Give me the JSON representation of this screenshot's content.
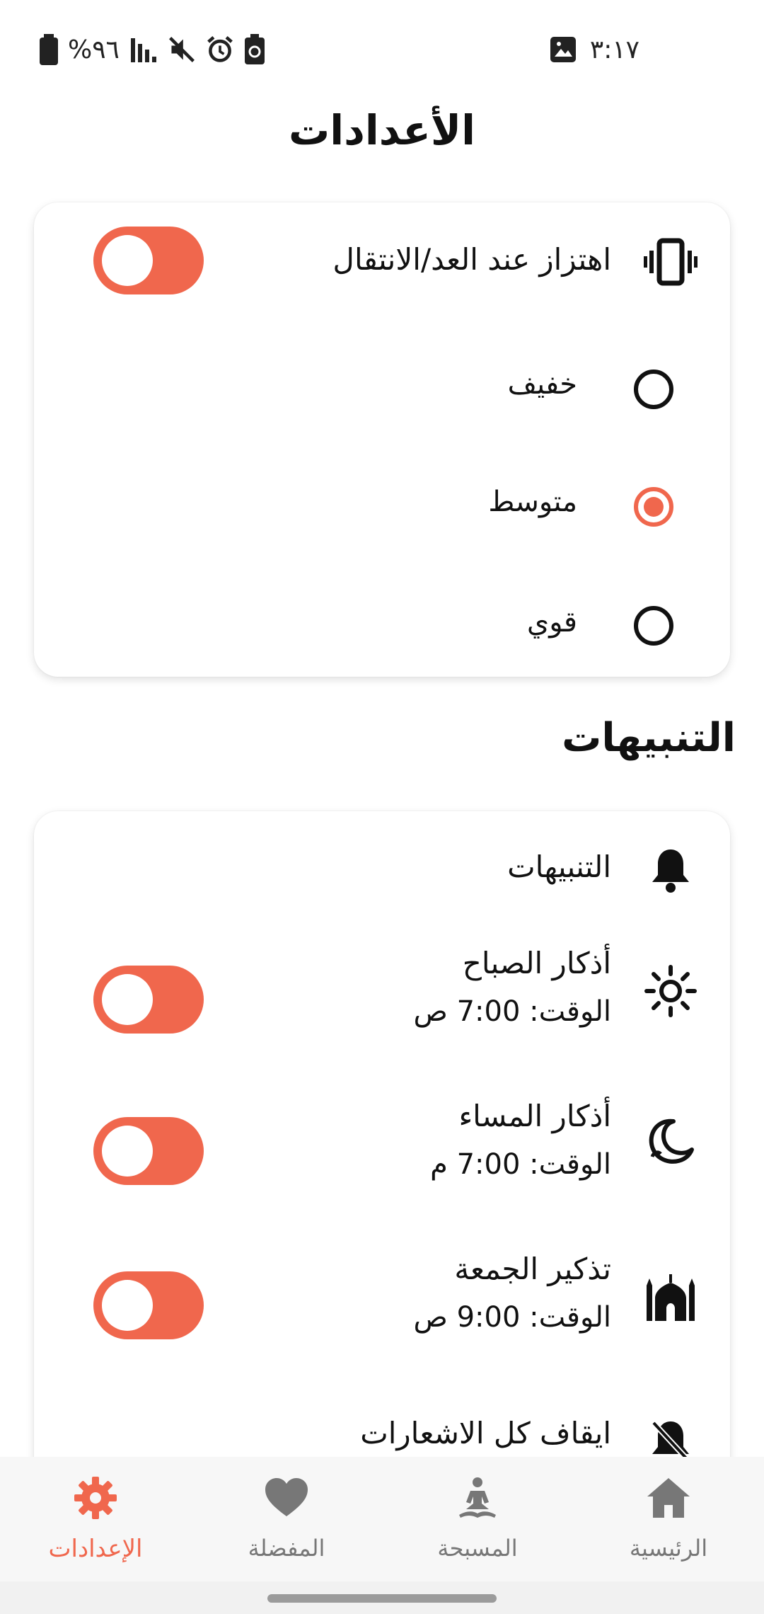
{
  "status_bar": {
    "time": "٣:١٧",
    "battery": "%٩٦",
    "icons": [
      "battery-icon",
      "signal-icon",
      "mute-icon",
      "alarm-icon",
      "battery-saver-icon",
      "gallery-icon"
    ]
  },
  "page": {
    "title": "الأعدادات"
  },
  "vibration": {
    "icon": "vibration-icon",
    "title": "اهتزاز عند العد/الانتقال",
    "enabled": true,
    "options": [
      {
        "label": "خفيف",
        "selected": false
      },
      {
        "label": "متوسط",
        "selected": true
      },
      {
        "label": "قوي",
        "selected": false
      }
    ]
  },
  "notifications_section": {
    "title": "التنبيهات",
    "header": {
      "icon": "bell-icon",
      "label": "التنبيهات"
    },
    "items": [
      {
        "icon": "sun-icon",
        "title": "أذكار الصباح",
        "time": "الوقت: 7:00 ص",
        "enabled": true
      },
      {
        "icon": "moon-icon",
        "title": "أذكار المساء",
        "time": "الوقت: 7:00 م",
        "enabled": true
      },
      {
        "icon": "mosque-icon",
        "title": "تذكير الجمعة",
        "time": "الوقت: 9:00 ص",
        "enabled": true
      },
      {
        "icon": "bell-off-icon",
        "title": "ايقاف كل الاشعارات"
      }
    ]
  },
  "bottom_nav": {
    "items": [
      {
        "label": "الإعدادات",
        "icon": "gear-icon",
        "active": true
      },
      {
        "label": "المفضلة",
        "icon": "heart-icon",
        "active": false
      },
      {
        "label": "المسبحة",
        "icon": "meditation-icon",
        "active": false
      },
      {
        "label": "الرئيسية",
        "icon": "home-icon",
        "active": false
      }
    ]
  },
  "colors": {
    "accent": "#f0674d",
    "inactive": "#777777",
    "text": "#111111"
  }
}
